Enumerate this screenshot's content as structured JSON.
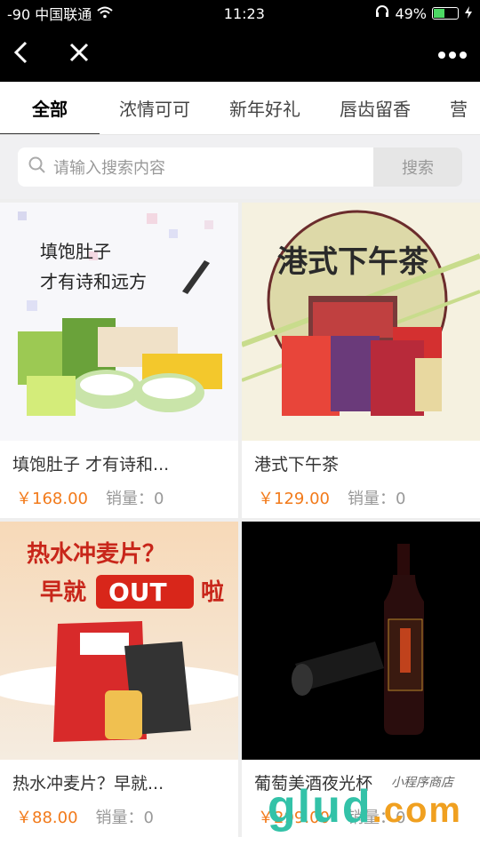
{
  "status": {
    "carrier": "-90 中国联通",
    "time": "11:23",
    "battery": "49%",
    "battery_level": 0.49
  },
  "tabs": [
    "全部",
    "浓情可可",
    "新年好礼",
    "唇齿留香",
    "营"
  ],
  "search": {
    "placeholder": "请输入搜索内容",
    "button": "搜索"
  },
  "products": [
    {
      "title": "填饱肚子 才有诗和...",
      "price": "￥168.00",
      "sales": "销量：0",
      "banner": [
        "填饱肚子",
        "才有诗和远方"
      ]
    },
    {
      "title": "港式下午茶",
      "price": "￥129.00",
      "sales": "销量：0",
      "banner": [
        "港式下午茶"
      ]
    },
    {
      "title": "热水冲麦片？早就...",
      "price": "￥88.00",
      "sales": "销量：0",
      "banner": [
        "热水冲麦片？",
        "早就",
        "OUT",
        "啦"
      ]
    },
    {
      "title": "葡萄美酒夜光杯",
      "price": "￥299.00",
      "sales": "销量：0",
      "banner": []
    }
  ],
  "watermark": {
    "main": "glud",
    "suffix": ".com",
    "sub": "小程序商店"
  }
}
